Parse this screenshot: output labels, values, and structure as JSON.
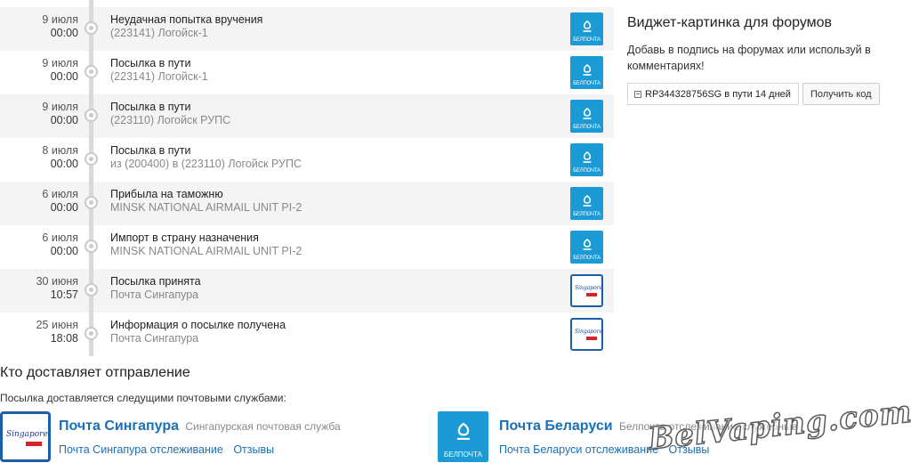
{
  "events": [
    {
      "date": "9 июля",
      "time": "00:00",
      "status": "Неудачная попытка вручения",
      "place": "(223141) Логойск-1",
      "carrier_logo": "belpochta-logo",
      "logo_caption": "БЕЛПОЧТА"
    },
    {
      "date": "9 июля",
      "time": "00:00",
      "status": "Посылка в пути",
      "place": "(223141) Логойск-1",
      "carrier_logo": "belpochta-logo",
      "logo_caption": "БЕЛПОЧТА"
    },
    {
      "date": "9 июля",
      "time": "00:00",
      "status": "Посылка в пути",
      "place": "(223110) Логойск РУПС",
      "carrier_logo": "belpochta-logo",
      "logo_caption": "БЕЛПОЧТА"
    },
    {
      "date": "8 июля",
      "time": "00:00",
      "status": "Посылка в пути",
      "place": "из (200400) в (223110) Логойск РУПС",
      "carrier_logo": "belpochta-logo",
      "logo_caption": "БЕЛПОЧТА"
    },
    {
      "date": "6 июля",
      "time": "00:00",
      "status": "Прибыла на таможню",
      "place": "MINSK NATIONAL AIRMAIL UNIT PI-2",
      "carrier_logo": "belpochta-logo",
      "logo_caption": "БЕЛПОЧТА"
    },
    {
      "date": "6 июля",
      "time": "00:00",
      "status": "Импорт в страну назначения",
      "place": "MINSK NATIONAL AIRMAIL UNIT PI-2",
      "carrier_logo": "belpochta-logo",
      "logo_caption": "БЕЛПОЧТА"
    },
    {
      "date": "30 июня",
      "time": "10:57",
      "status": "Посылка принята",
      "place": "Почта Сингапура",
      "carrier_logo": "singpost-logo",
      "logo_caption": "Singapore"
    },
    {
      "date": "25 июня",
      "time": "18:08",
      "status": "Информация о посылке получена",
      "place": "Почта Сингапура",
      "carrier_logo": "singpost-logo",
      "logo_caption": "Singapore"
    }
  ],
  "widget": {
    "title": "Виджет-картинка для форумов",
    "description": "Добавь в подпись на форумах или используй в комментариях!",
    "badge_text": "RP344328756SG в пути 14 дней",
    "button_label": "Получить код"
  },
  "carriers_section": {
    "title": "Кто доставляет отправление",
    "subtitle": "Посылка доставляется следущими почтовыми службами:"
  },
  "carriers": [
    {
      "name": "Почта Сингапура",
      "desc": "Сингапурская почтовая служба",
      "tracking_link": "Почта Сингапура отслеживание",
      "reviews_link": "Отзывы",
      "logo_caption": "Singapore"
    },
    {
      "name": "Почта Беларуси",
      "desc": "Белпочта отслеживание служебные",
      "tracking_link": "Почта Беларуси отслеживание",
      "reviews_link": "Отзывы",
      "logo_caption": "БЕЛПОЧТА"
    }
  ],
  "watermark": "BelVaping.com",
  "colors": {
    "link": "#1a6fb6",
    "belpochta_blue": "#1c9ad6",
    "singpost_red": "#d5232b",
    "singpost_blue": "#1a5fa8"
  }
}
